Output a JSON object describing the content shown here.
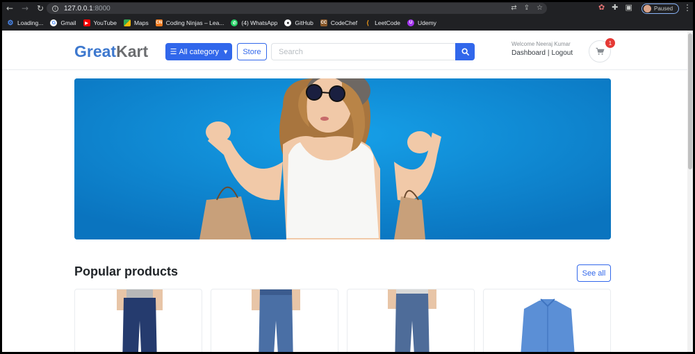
{
  "browser": {
    "url_host": "127.0.0.1",
    "url_port": ":8000",
    "profile_status": "Paused",
    "bookmarks": [
      {
        "label": "Loading...",
        "icon": "loading-icon",
        "color": "#4b8bf5"
      },
      {
        "label": "Gmail",
        "icon": "google-icon",
        "color": "#ffffff"
      },
      {
        "label": "YouTube",
        "icon": "youtube-icon",
        "color": "#ff0000"
      },
      {
        "label": "Maps",
        "icon": "maps-icon",
        "color": "#34a853"
      },
      {
        "label": "Coding Ninjas – Lea...",
        "icon": "coding-ninjas-icon",
        "color": "#f57c1f"
      },
      {
        "label": "(4) WhatsApp",
        "icon": "whatsapp-icon",
        "color": "#25d366"
      },
      {
        "label": "GitHub",
        "icon": "github-icon",
        "color": "#ffffff"
      },
      {
        "label": "CodeChef",
        "icon": "codechef-icon",
        "color": "#8b5a2b"
      },
      {
        "label": "LeetCode",
        "icon": "leetcode-icon",
        "color": "#ffa116"
      },
      {
        "label": "Udemy",
        "icon": "udemy-icon",
        "color": "#a435f0"
      }
    ]
  },
  "header": {
    "logo_great": "Great",
    "logo_kart": "Kart",
    "category_button": "All category",
    "store_button": "Store",
    "search_placeholder": "Search",
    "welcome": "Welcome Neeraj Kumar",
    "dashboard_link": "Dashboard",
    "separator": "|",
    "logout_link": "Logout",
    "cart_count": "1"
  },
  "products_section": {
    "title": "Popular products",
    "see_all": "See all"
  },
  "colors": {
    "primary": "#3167eb",
    "logo_blue": "#3d78ce",
    "logo_gray": "#6b6d70",
    "badge_red": "#e53935",
    "banner_blue": "#0a84cf"
  }
}
